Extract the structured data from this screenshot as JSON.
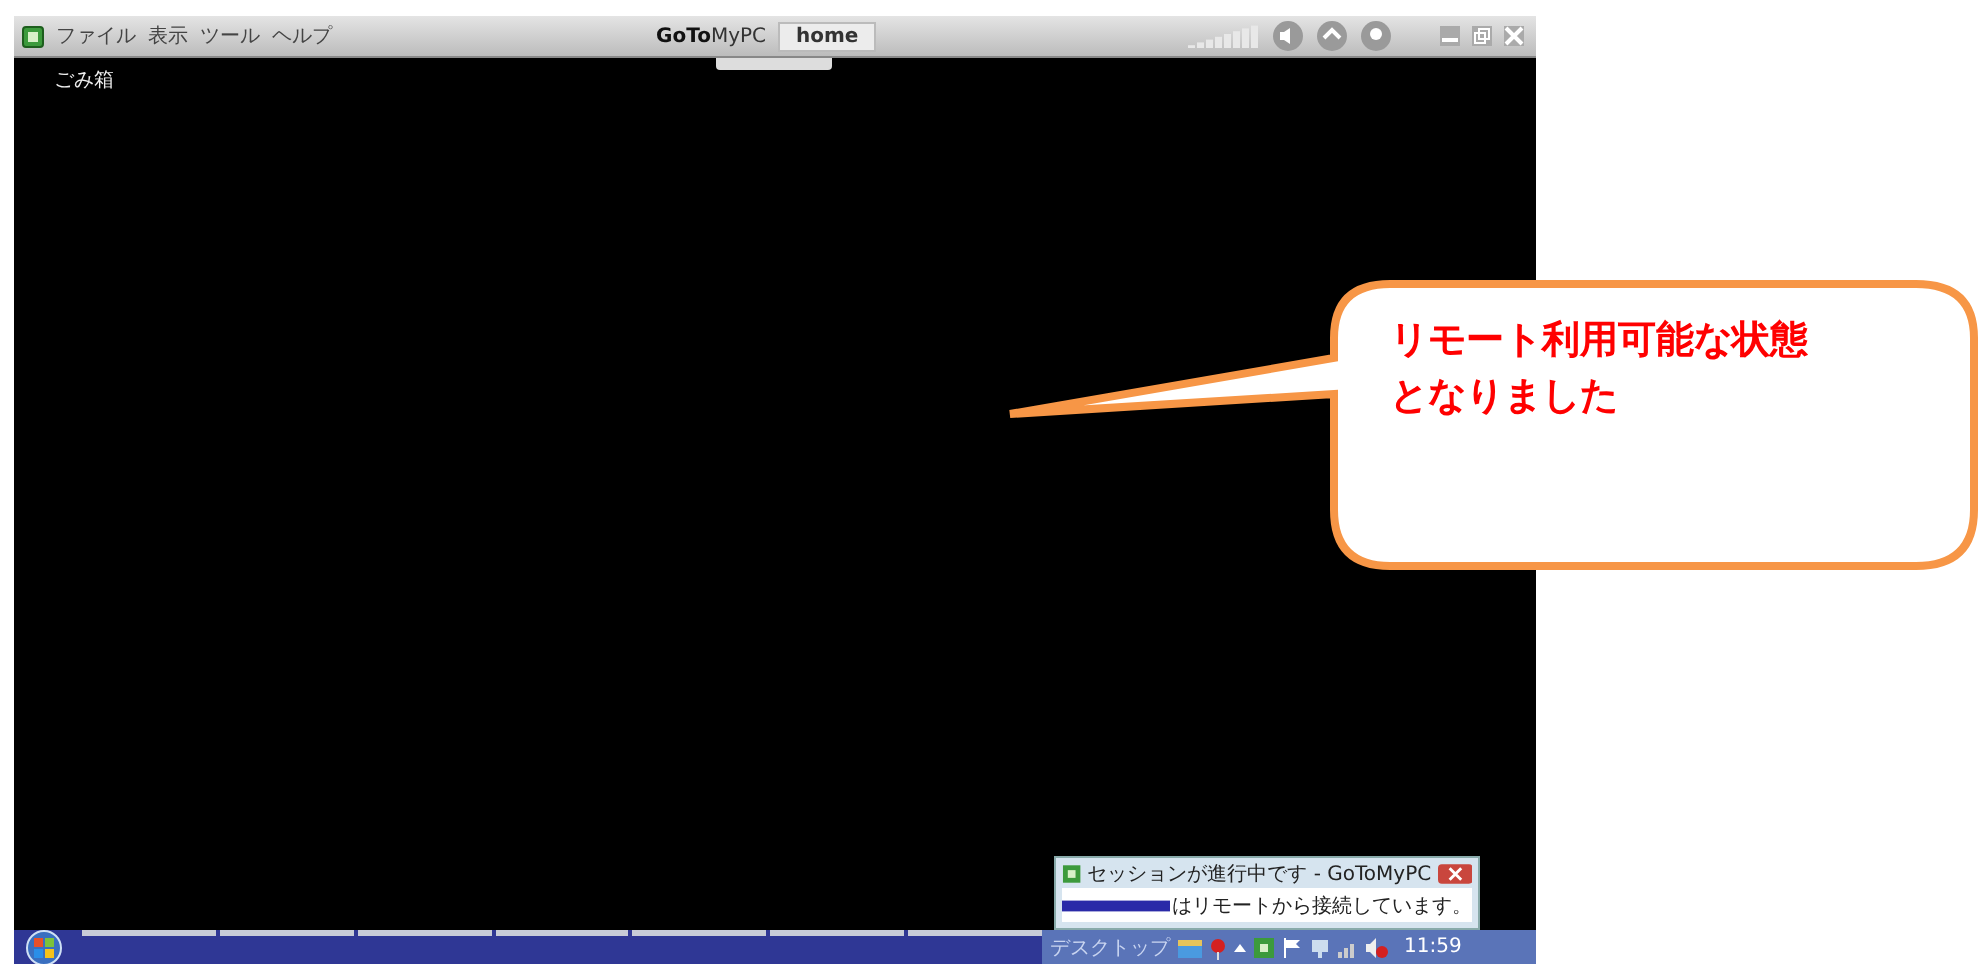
{
  "app_toolbar": {
    "menu": [
      {
        "label": "ファイル"
      },
      {
        "label": "表示"
      },
      {
        "label": "ツール"
      },
      {
        "label": "ヘルプ"
      }
    ],
    "logo": "**GoTo**MyPC",
    "computer_name": "home"
  },
  "desktop": {
    "icons": [
      {
        "label": "ごみ箱"
      }
    ]
  },
  "notification": {
    "title": "セッションが進行中です - GoToMyPC",
    "message": "はリモートから接続しています。"
  },
  "taskbar": {
    "toolbar_label": "デスクトップ",
    "clock": "11:59"
  },
  "callout": {
    "lines": [
      "リモート利用可能な状態",
      "となりました"
    ]
  }
}
